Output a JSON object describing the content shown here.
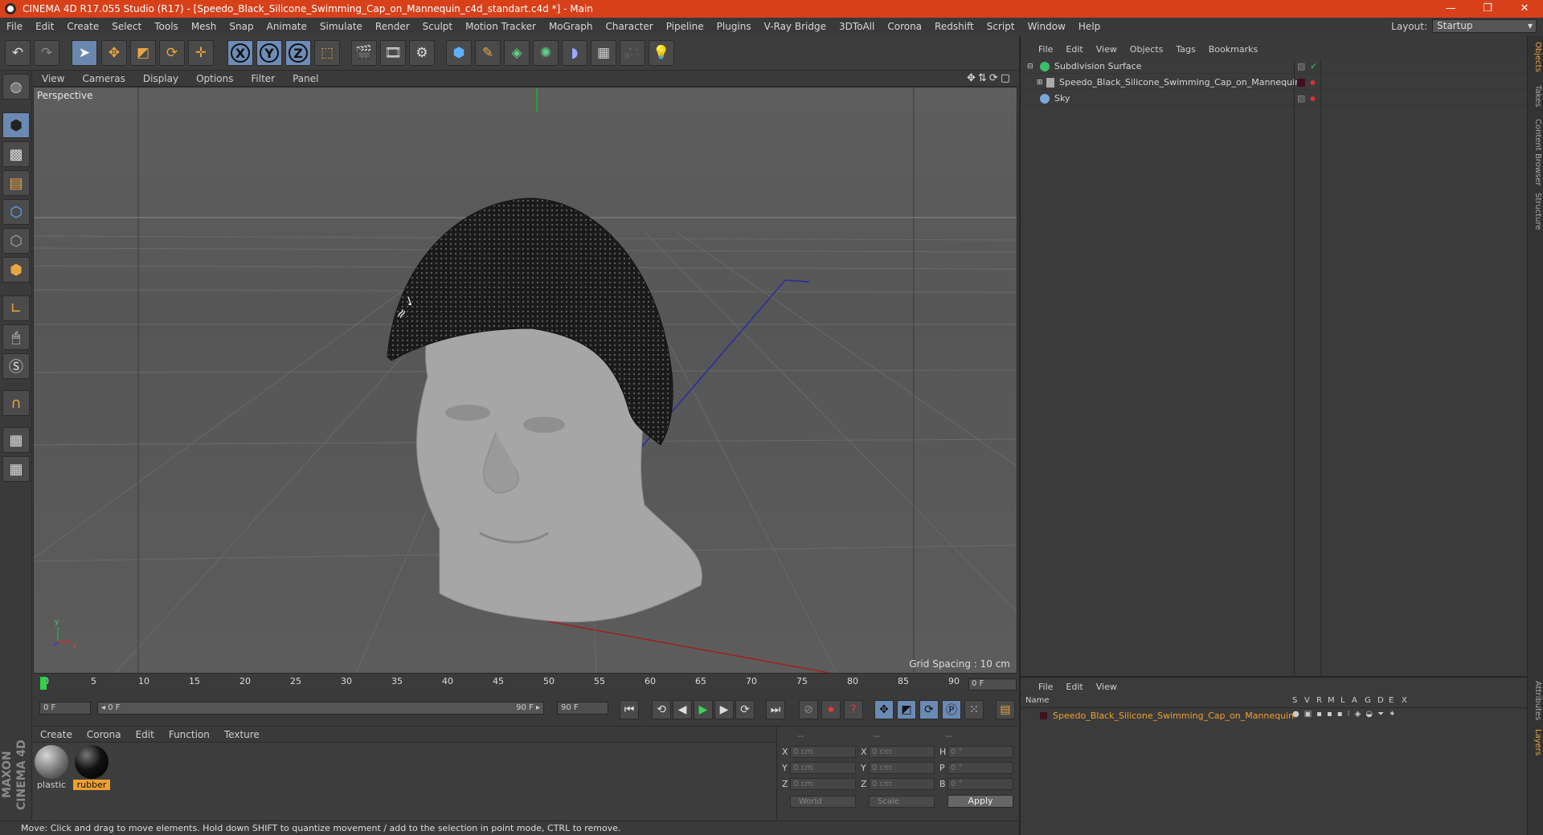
{
  "window": {
    "title": "CINEMA 4D R17.055 Studio (R17) - [Speedo_Black_Silicone_Swimming_Cap_on_Mannequin_c4d_standart.c4d *] - Main",
    "controls": [
      "—",
      "❐",
      "✕"
    ]
  },
  "menu": [
    "File",
    "Edit",
    "Create",
    "Select",
    "Tools",
    "Mesh",
    "Snap",
    "Animate",
    "Simulate",
    "Render",
    "Sculpt",
    "Motion Tracker",
    "MoGraph",
    "Character",
    "Pipeline",
    "Plugins",
    "V-Ray Bridge",
    "3DToAll",
    "Corona",
    "Redshift",
    "Script",
    "Window",
    "Help"
  ],
  "layout": {
    "label": "Layout:",
    "value": "Startup"
  },
  "viewport": {
    "menu": [
      "View",
      "Cameras",
      "Display",
      "Options",
      "Filter",
      "Panel"
    ],
    "label": "Perspective",
    "grid_spacing": "Grid Spacing : 10 cm",
    "icons": "✥⇅⟳▢"
  },
  "timeline": {
    "ticks": [
      "0",
      "5",
      "10",
      "15",
      "20",
      "25",
      "30",
      "35",
      "40",
      "45",
      "50",
      "55",
      "60",
      "65",
      "70",
      "75",
      "80",
      "85",
      "90"
    ],
    "current_frame": "0 F",
    "start_field": "0 F",
    "slider_start": "◂ 0 F",
    "slider_end": "90 F ▸",
    "end_field": "90 F"
  },
  "material_menu": [
    "Create",
    "Corona",
    "Edit",
    "Function",
    "Texture"
  ],
  "materials": [
    {
      "label": "plastic",
      "color": "#8a8a8a",
      "selected": false
    },
    {
      "label": "rubber",
      "color": "#111111",
      "selected": true
    }
  ],
  "coords": {
    "header": [
      "--",
      "--",
      "--"
    ],
    "rows": [
      {
        "a": "X",
        "av": "0 cm",
        "b": "X",
        "bv": "0 cm",
        "c": "H",
        "cv": "0 °"
      },
      {
        "a": "Y",
        "av": "0 cm",
        "b": "Y",
        "bv": "0 cm",
        "c": "P",
        "cv": "0 °"
      },
      {
        "a": "Z",
        "av": "0 cm",
        "b": "Z",
        "bv": "0 cm",
        "c": "B",
        "cv": "0 °"
      }
    ],
    "mode1": "World",
    "mode2": "Scale",
    "apply": "Apply"
  },
  "status": "Move: Click and drag to move elements. Hold down SHIFT to quantize movement / add to the selection in point mode, CTRL to remove.",
  "objects": {
    "menu": [
      "File",
      "Edit",
      "View",
      "Objects",
      "Tags",
      "Bookmarks"
    ],
    "items": [
      {
        "name": "Subdivision Surface",
        "color": "#3bbf6a"
      },
      {
        "name": "Speedo_Black_Silicone_Swimming_Cap_on_Mannequin",
        "color": "#aaaaaa"
      },
      {
        "name": "Sky",
        "color": "#7aa7d8"
      }
    ]
  },
  "layers": {
    "menu": [
      "File",
      "Edit",
      "View"
    ],
    "header": {
      "name": "Name",
      "flags": [
        "S",
        "V",
        "R",
        "M",
        "L",
        "A",
        "G",
        "D",
        "E",
        "X"
      ]
    },
    "row": "Speedo_Black_Silicone_Swimming_Cap_on_Mannequin"
  },
  "side_tabs": [
    "Objects",
    "Takes",
    "Content Browser",
    "Structure",
    "Attributes",
    "Layers"
  ],
  "brand": "MAXON CINEMA 4D"
}
